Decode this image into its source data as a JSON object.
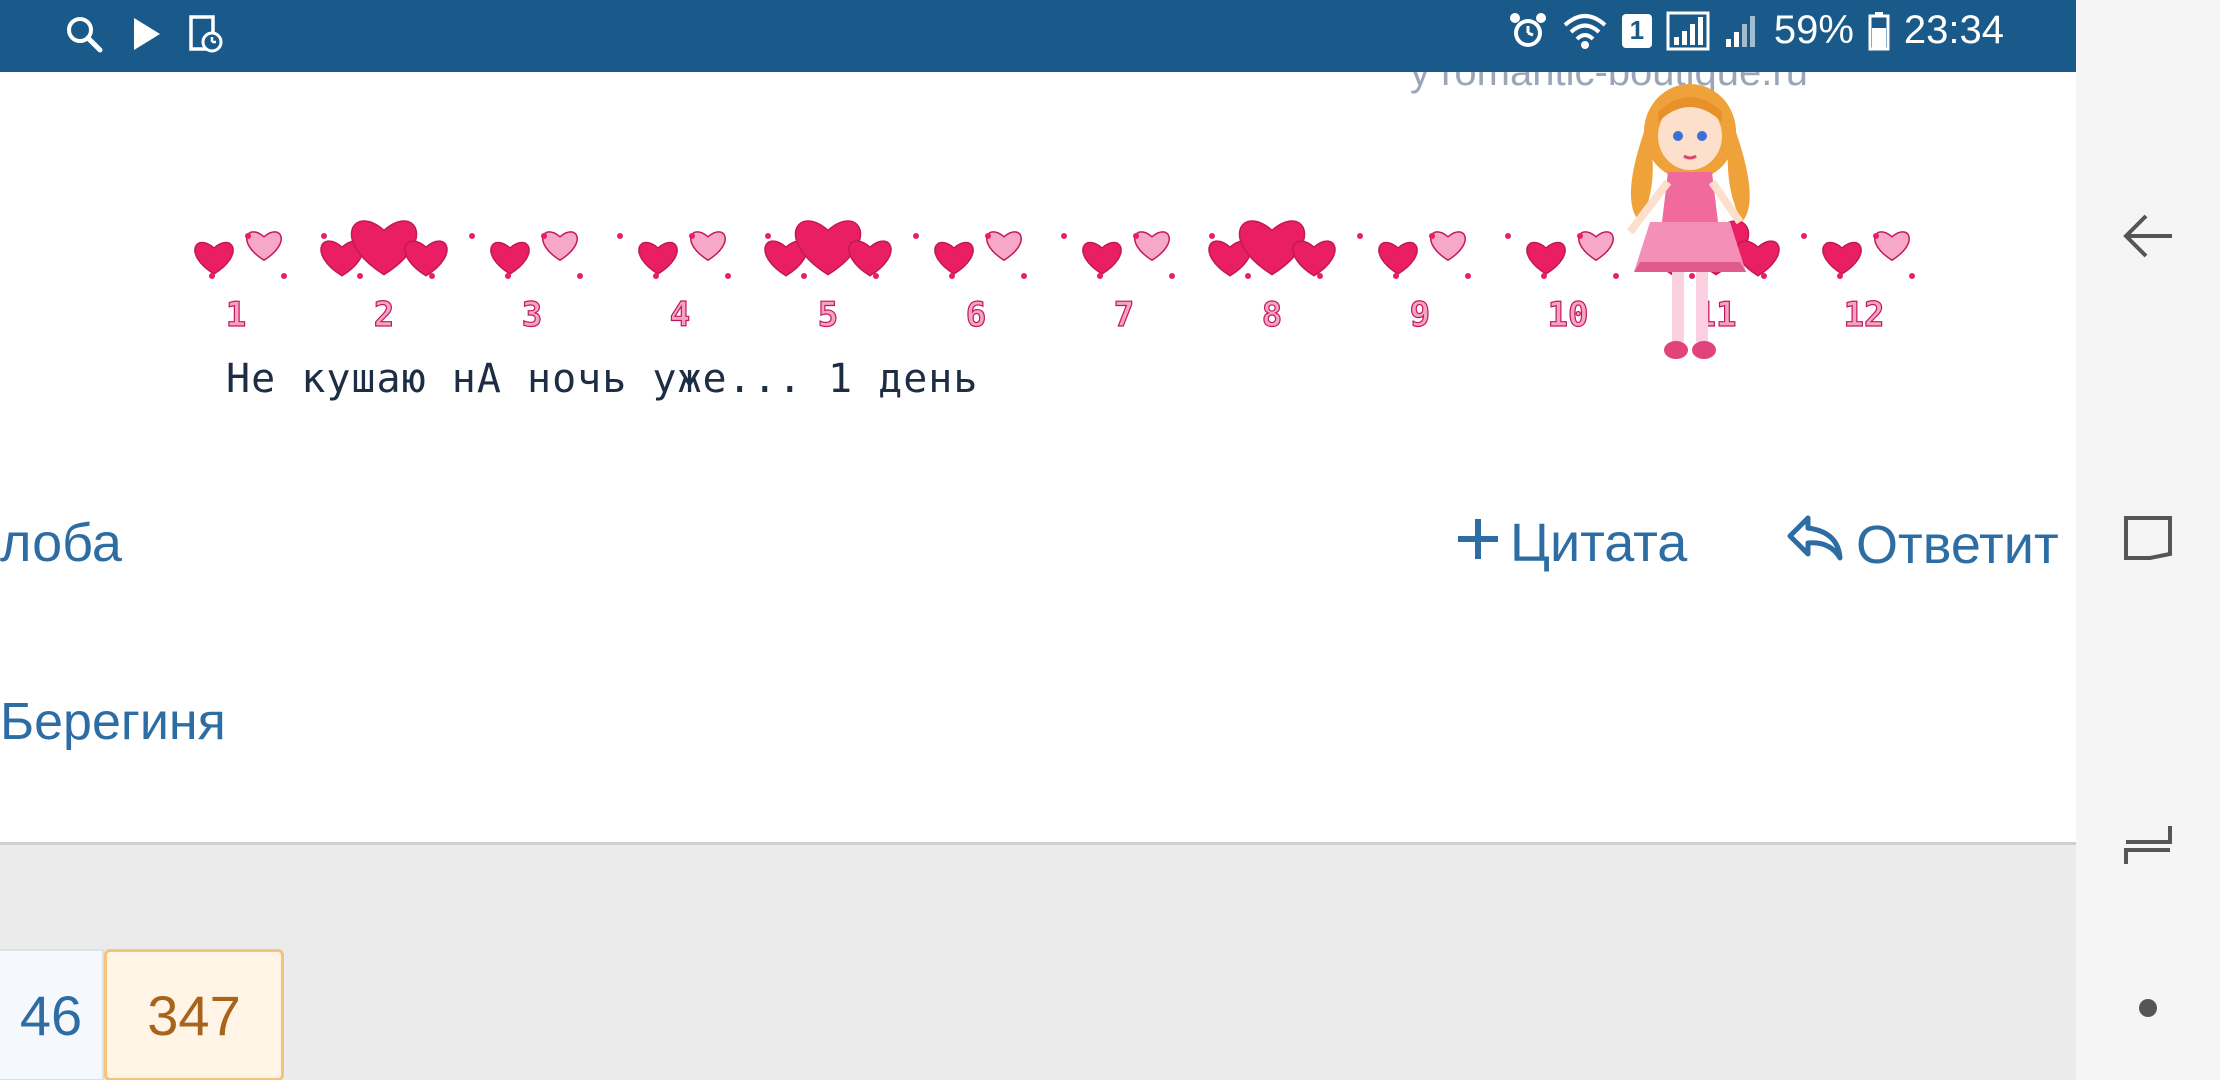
{
  "status_bar": {
    "battery": "59%",
    "time": "23:34",
    "sim_badge": "1",
    "icons": [
      "search-icon",
      "play-icon",
      "file-clock-icon",
      "alarm-icon",
      "wifi-icon",
      "signal-icon",
      "signal-icon",
      "battery-icon"
    ]
  },
  "signature": {
    "top_text": "y romantic-boutique.ru",
    "heart_numbers": [
      "1",
      "2",
      "3",
      "4",
      "5",
      "6",
      "7",
      "8",
      "9",
      "10",
      "11",
      "12"
    ],
    "caption": "Не кушаю нА ночь уже... 1 день"
  },
  "actions": {
    "complain_label": "лоба",
    "quote_label": "Цитата",
    "reply_label": "Ответит"
  },
  "author": {
    "name": "Берегиня"
  },
  "pagination": {
    "prev_page": "46",
    "current_page": "347"
  },
  "colors": {
    "status_bar": "#1a5a8a",
    "link": "#2e6da4",
    "current_page_bg": "#fff4e6",
    "current_page_text": "#a7651b",
    "heart_pink": "#e91e63"
  }
}
